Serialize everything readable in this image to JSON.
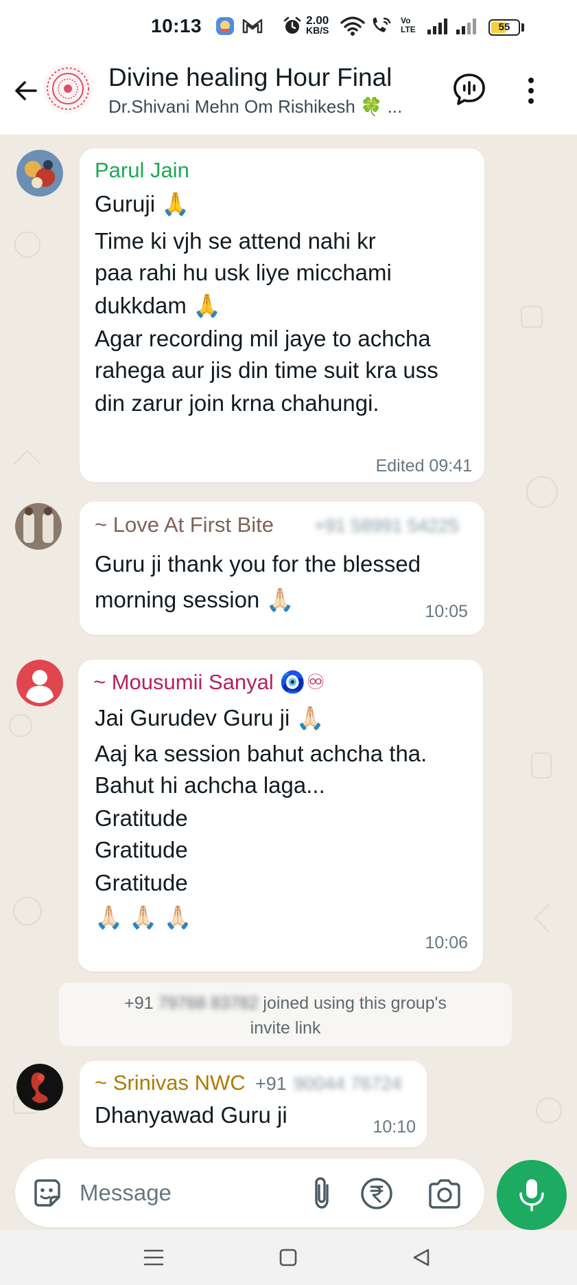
{
  "status_bar": {
    "time": "10:13",
    "net_speed_value": "2.00",
    "net_speed_unit": "KB/S",
    "volte_top": "Vo",
    "volte_bottom": "LTE",
    "battery": "55",
    "icons": [
      "app-notification-icon",
      "gmail-icon",
      "alarm-icon",
      "wifi-icon",
      "wifi-calling-icon",
      "signal-icon",
      "battery-icon"
    ]
  },
  "header": {
    "title": "Divine healing Hour Final",
    "subtitle": "Dr.Shivani Mehn Om Rishikesh 🍀 ..."
  },
  "messages": [
    {
      "sender": "Parul Jain",
      "sender_color": "#1fa855",
      "lines": [
        "Guruji 🙏",
        "Time ki vjh se attend nahi kr",
        "paa rahi hu usk liye micchami",
        "dukkdam 🙏",
        "Agar recording mil jaye to achcha",
        "rahega aur jis din time suit kra uss",
        "din zarur join krna chahungi."
      ],
      "time": "Edited 09:41"
    },
    {
      "sender": "~ Love At First Bite",
      "sender_color": "#7d6257",
      "phone": "+91 58991 54225",
      "lines": [
        "Guru ji thank you for the blessed",
        "morning session 🙏🏻"
      ],
      "time": "10:05"
    },
    {
      "sender": "~ Mousumii Sanyal 🧿♾",
      "sender_color": "#b4215e",
      "lines": [
        "Jai Gurudev Guru ji 🙏🏻",
        "Aaj ka session bahut achcha tha.",
        "Bahut hi achcha laga...",
        "Gratitude",
        "Gratitude",
        "Gratitude",
        "🙏🏻 🙏🏻 🙏🏻"
      ],
      "time": "10:06"
    },
    {
      "sender": "~ Srinivas NWC",
      "sender_color": "#b07a00",
      "phone_prefix": "+91",
      "phone": "90044 76724",
      "lines": [
        "Dhanyawad Guru ji"
      ],
      "time": "10:10"
    }
  ],
  "system_message": {
    "prefix": "+91",
    "phone": "79768 83782",
    "text_1": "joined using this group's",
    "text_2": "invite link"
  },
  "input": {
    "placeholder": "Message"
  },
  "colors": {
    "accent_green": "#1daa61",
    "chat_bg": "#efeae2"
  }
}
